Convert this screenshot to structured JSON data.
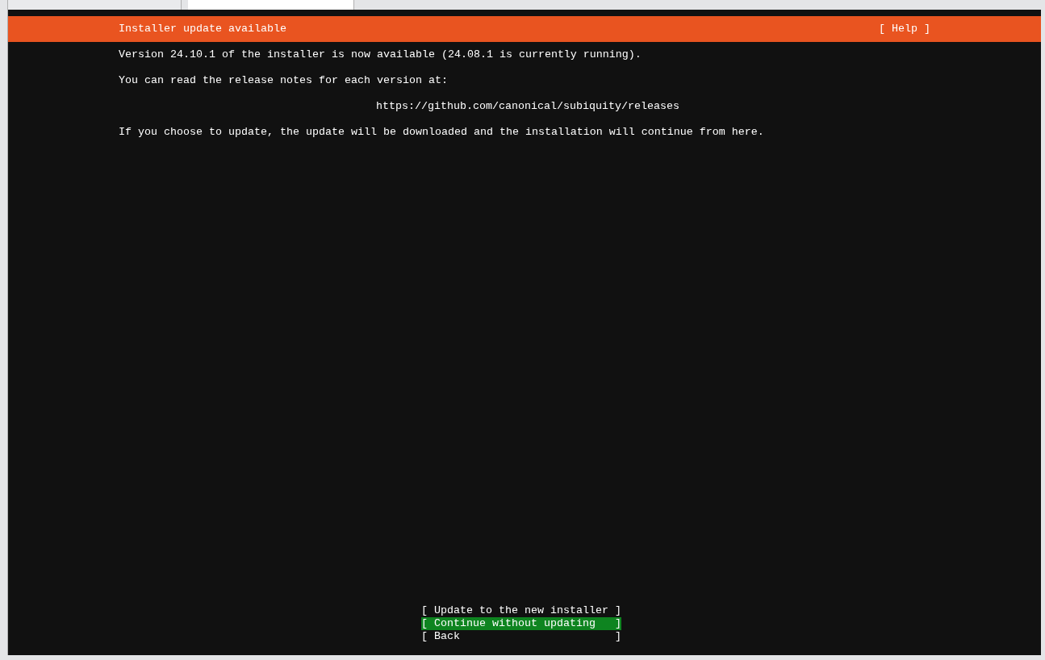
{
  "header": {
    "title": "Installer update available",
    "help": "[ Help ]"
  },
  "paragraphs": [
    {
      "kind": "text",
      "text": "Version 24.10.1 of the installer is now available (24.08.1 is currently running)."
    },
    {
      "kind": "text",
      "text": "You can read the release notes for each version at:"
    },
    {
      "kind": "link",
      "text": "https://github.com/canonical/subiquity/releases"
    },
    {
      "kind": "text",
      "text": "If you choose to update, the update will be downloaded and the installation will continue from here."
    }
  ],
  "buttons": [
    {
      "label": "[ Update to the new installer ]",
      "selected": false
    },
    {
      "label": "[ Continue without updating   ]",
      "selected": true
    },
    {
      "label": "[ Back                        ]",
      "selected": false
    }
  ]
}
